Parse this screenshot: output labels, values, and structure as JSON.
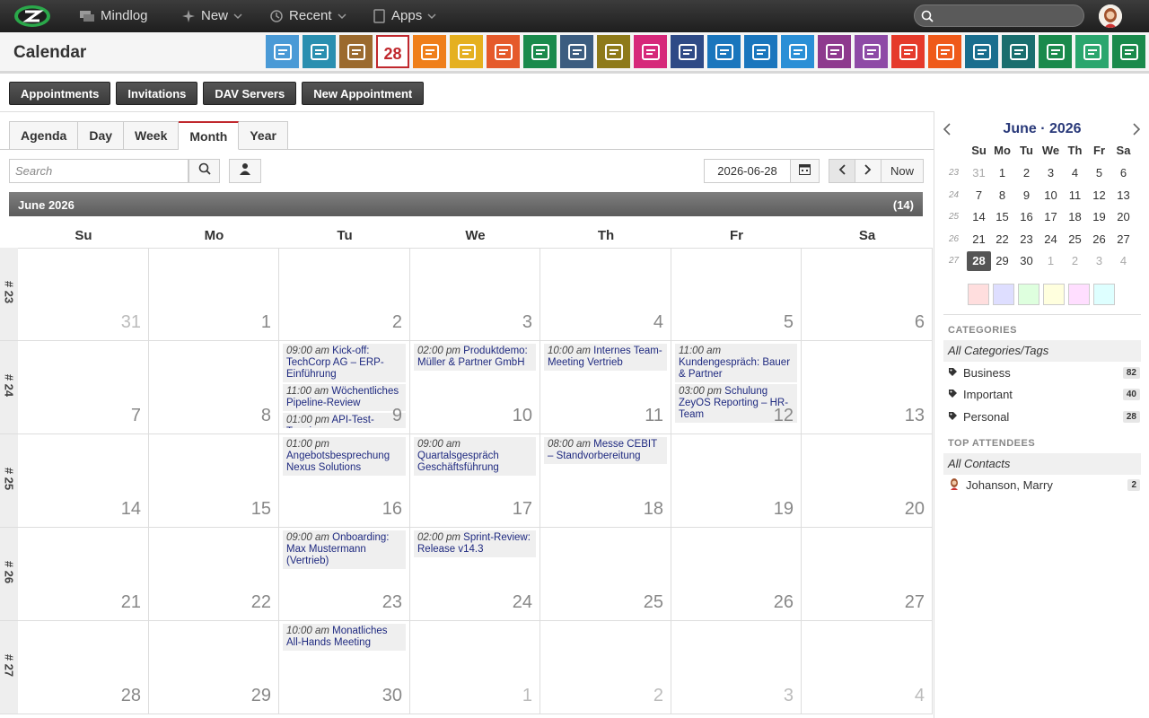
{
  "topbar": {
    "nav": [
      {
        "label": "Mindlog",
        "icon": "chat-icon"
      },
      {
        "label": "New",
        "icon": "sparkle-icon"
      },
      {
        "label": "Recent",
        "icon": "history-icon"
      },
      {
        "label": "Apps",
        "icon": "tablet-icon"
      }
    ],
    "search_placeholder": ""
  },
  "header": {
    "title": "Calendar",
    "apps": [
      {
        "name": "mail-app",
        "color": "#4a9ad6"
      },
      {
        "name": "contacts-email-app",
        "color": "#2a8fb0"
      },
      {
        "name": "addressbook-app",
        "color": "#9b6a2e"
      },
      {
        "name": "calendar-app",
        "color": "#c0282d",
        "text": "28"
      },
      {
        "name": "timer-app",
        "color": "#ef7f1a"
      },
      {
        "name": "tasks-app",
        "color": "#e5b020"
      },
      {
        "name": "projects-app",
        "color": "#e55a2b"
      },
      {
        "name": "notes-app",
        "color": "#1a8a4c"
      },
      {
        "name": "bookmarks-app",
        "color": "#3c5d80"
      },
      {
        "name": "documents-app",
        "color": "#8e7a1a"
      },
      {
        "name": "shop-app",
        "color": "#d6287a"
      },
      {
        "name": "finance-app",
        "color": "#2e4a86"
      },
      {
        "name": "delivery-app",
        "color": "#1a76bd"
      },
      {
        "name": "service-app",
        "color": "#1a76bd"
      },
      {
        "name": "payment-app",
        "color": "#2a8fd6"
      },
      {
        "name": "contracts-app",
        "color": "#8e3a8e"
      },
      {
        "name": "deals-app",
        "color": "#8e4aa6"
      },
      {
        "name": "pdf-app",
        "color": "#e53a2b"
      },
      {
        "name": "broadcast-app",
        "color": "#ef5a1a"
      },
      {
        "name": "download-app",
        "color": "#1a6e8e"
      },
      {
        "name": "cart-app",
        "color": "#1a6e6e"
      },
      {
        "name": "accounting-app",
        "color": "#1a8a4c"
      },
      {
        "name": "pricing-app",
        "color": "#2aa66e"
      },
      {
        "name": "database-app",
        "color": "#1a8a4c"
      }
    ]
  },
  "actions": [
    "Appointments",
    "Invitations",
    "DAV Servers",
    "New Appointment"
  ],
  "tabs": [
    "Agenda",
    "Day",
    "Week",
    "Month",
    "Year"
  ],
  "active_tab": "Month",
  "search": {
    "placeholder": "Search"
  },
  "date": "2026-06-28",
  "now_label": "Now",
  "month": {
    "title": "June 2026",
    "count": "(14)"
  },
  "weekdays": [
    "Su",
    "Mo",
    "Tu",
    "We",
    "Th",
    "Fr",
    "Sa"
  ],
  "weeks": [
    {
      "label": "# 23",
      "days": [
        {
          "n": "31",
          "o": true
        },
        {
          "n": "1"
        },
        {
          "n": "2"
        },
        {
          "n": "3"
        },
        {
          "n": "4"
        },
        {
          "n": "5"
        },
        {
          "n": "6"
        }
      ]
    },
    {
      "label": "# 24",
      "days": [
        {
          "n": "7"
        },
        {
          "n": "8"
        },
        {
          "n": "9"
        },
        {
          "n": "10"
        },
        {
          "n": "11"
        },
        {
          "n": "12"
        },
        {
          "n": "13"
        }
      ]
    },
    {
      "label": "# 25",
      "days": [
        {
          "n": "14"
        },
        {
          "n": "15"
        },
        {
          "n": "16"
        },
        {
          "n": "17"
        },
        {
          "n": "18"
        },
        {
          "n": "19"
        },
        {
          "n": "20"
        }
      ]
    },
    {
      "label": "# 26",
      "days": [
        {
          "n": "21"
        },
        {
          "n": "22"
        },
        {
          "n": "23"
        },
        {
          "n": "24"
        },
        {
          "n": "25"
        },
        {
          "n": "26"
        },
        {
          "n": "27"
        }
      ]
    },
    {
      "label": "# 27",
      "days": [
        {
          "n": "28"
        },
        {
          "n": "29"
        },
        {
          "n": "30"
        },
        {
          "n": "1",
          "o": true
        },
        {
          "n": "2",
          "o": true
        },
        {
          "n": "3",
          "o": true
        },
        {
          "n": "4",
          "o": true
        }
      ]
    }
  ],
  "events": [
    {
      "week": 1,
      "day": 2,
      "time": "09:00 am",
      "title": "Kick-off: TechCorp AG – ERP-Einführung",
      "lines": 3
    },
    {
      "week": 1,
      "day": 2,
      "time": "11:00 am",
      "title": "Wöchentliches Pipeline-Review",
      "lines": 2
    },
    {
      "week": 1,
      "day": 2,
      "time": "01:00 pm",
      "title": "API-Test-Termin",
      "lines": 1
    },
    {
      "week": 1,
      "day": 3,
      "time": "02:00 pm",
      "title": "Produktdemo: Müller & Partner GmbH",
      "lines": 2
    },
    {
      "week": 1,
      "day": 4,
      "time": "10:00 am",
      "title": "Internes Team-Meeting Vertrieb",
      "lines": 2
    },
    {
      "week": 1,
      "day": 5,
      "time": "11:00 am",
      "title": "Kundengespräch: Bauer & Partner",
      "lines": 3
    },
    {
      "week": 1,
      "day": 5,
      "time": "03:00 pm",
      "title": "Schulung ZeyOS Reporting – HR-Team",
      "lines": 3
    },
    {
      "week": 2,
      "day": 2,
      "time": "01:00 pm",
      "title": "Angebotsbesprechung Nexus Solutions",
      "lines": 3
    },
    {
      "week": 2,
      "day": 3,
      "time": "09:00 am",
      "title": "Quartalsgespräch Geschäftsführung",
      "lines": 3
    },
    {
      "week": 2,
      "day": 4,
      "time": "08:00 am",
      "title": "Messe CEBIT – Standvorbereitung",
      "lines": 2
    },
    {
      "week": 3,
      "day": 2,
      "time": "09:00 am",
      "title": "Onboarding: Max Mustermann (Vertrieb)",
      "lines": 3
    },
    {
      "week": 3,
      "day": 3,
      "time": "02:00 pm",
      "title": "Sprint-Review: Release v14.3",
      "lines": 2
    },
    {
      "week": 4,
      "day": 2,
      "time": "10:00 am",
      "title": "Monatliches All-Hands Meeting",
      "lines": 2
    }
  ],
  "mini": {
    "title": "June · 2026",
    "heads": [
      "Su",
      "Mo",
      "Tu",
      "We",
      "Th",
      "Fr",
      "Sa"
    ],
    "rows": [
      {
        "wk": "23",
        "days": [
          {
            "n": "31",
            "o": true
          },
          {
            "n": "1"
          },
          {
            "n": "2"
          },
          {
            "n": "3"
          },
          {
            "n": "4"
          },
          {
            "n": "5"
          },
          {
            "n": "6"
          }
        ]
      },
      {
        "wk": "24",
        "days": [
          {
            "n": "7"
          },
          {
            "n": "8"
          },
          {
            "n": "9"
          },
          {
            "n": "10"
          },
          {
            "n": "11"
          },
          {
            "n": "12"
          },
          {
            "n": "13"
          }
        ]
      },
      {
        "wk": "25",
        "days": [
          {
            "n": "14"
          },
          {
            "n": "15"
          },
          {
            "n": "16"
          },
          {
            "n": "17"
          },
          {
            "n": "18"
          },
          {
            "n": "19"
          },
          {
            "n": "20"
          }
        ]
      },
      {
        "wk": "26",
        "days": [
          {
            "n": "21"
          },
          {
            "n": "22"
          },
          {
            "n": "23"
          },
          {
            "n": "24"
          },
          {
            "n": "25"
          },
          {
            "n": "26"
          },
          {
            "n": "27"
          }
        ]
      },
      {
        "wk": "27",
        "days": [
          {
            "n": "28",
            "t": true
          },
          {
            "n": "29"
          },
          {
            "n": "30"
          },
          {
            "n": "1",
            "o": true
          },
          {
            "n": "2",
            "o": true
          },
          {
            "n": "3",
            "o": true
          },
          {
            "n": "4",
            "o": true
          }
        ]
      }
    ]
  },
  "swatches": [
    "#ffdede",
    "#dedeff",
    "#deffde",
    "#ffffde",
    "#ffdeff",
    "#deffff"
  ],
  "categories": {
    "title": "CATEGORIES",
    "all": "All Categories/Tags",
    "items": [
      {
        "label": "Business",
        "count": "82"
      },
      {
        "label": "Important",
        "count": "40"
      },
      {
        "label": "Personal",
        "count": "28"
      }
    ]
  },
  "attendees": {
    "title": "TOP ATTENDEES",
    "all": "All Contacts",
    "items": [
      {
        "label": "Johanson, Marry",
        "count": "2"
      }
    ]
  }
}
